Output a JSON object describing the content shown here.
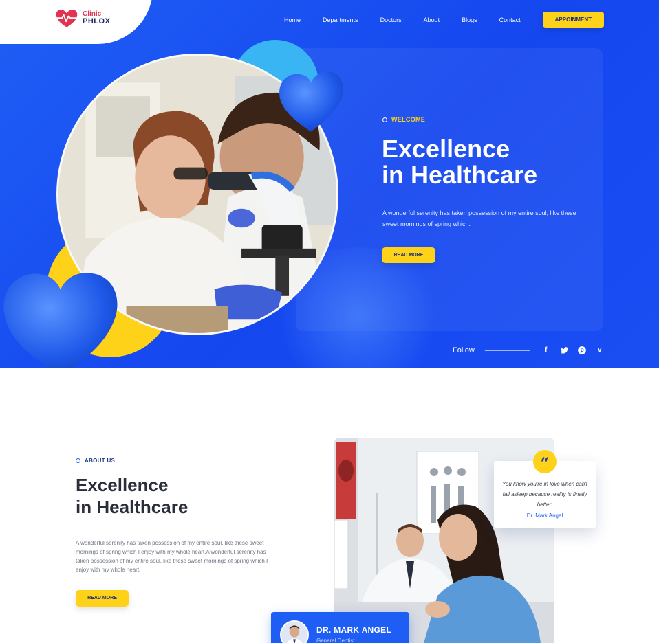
{
  "logo": {
    "sub": "Clinic",
    "main": "PHLOX"
  },
  "nav": {
    "items": [
      "Home",
      "Departments",
      "Doctors",
      "About",
      "Blogs",
      "Contact"
    ],
    "cta": "APPOINMENT"
  },
  "hero": {
    "eyebrow": "WELCOME",
    "title_line1": "Excellence",
    "title_line2": "in Healthcare",
    "text": "A wonderful serenity has taken possession of my entire soul, like these sweet mornings of spring which.",
    "button": "READ MORE",
    "follow_label": "Follow",
    "social": [
      "facebook-icon",
      "twitter-icon",
      "pinterest-icon",
      "vimeo-icon"
    ]
  },
  "about": {
    "eyebrow": "ABOUT US",
    "title_line1": "Excellence",
    "title_line2": "in Healthcare",
    "text": "A wonderful serenity has taken possession of my entire soul, like these sweet mornings of spring which I enjoy with my whole heart.A wonderful serenity has taken possession of my entire soul, like these sweet mornings of spring which I enjoy with my whole heart.",
    "button": "READ MORE"
  },
  "quote": {
    "mark": "“",
    "text": "You know you're in love when can't fall asleep because reality is finally better.",
    "author": "Dr. Mark Angel"
  },
  "doctor": {
    "name": "DR. MARK ANGEL",
    "role": "General Dentist"
  },
  "colors": {
    "primary": "#1f5ef5",
    "accent": "#ffd21a",
    "heart": "#e23350",
    "teal": "#3ab5f4"
  }
}
